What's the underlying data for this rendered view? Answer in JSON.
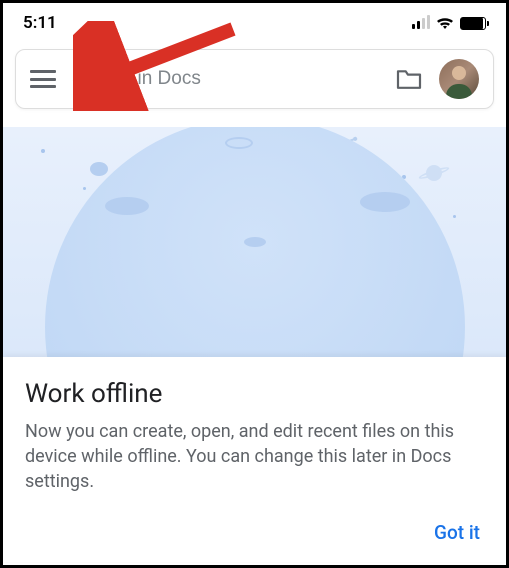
{
  "status_bar": {
    "time": "5:11"
  },
  "search": {
    "placeholder": "Search in Docs"
  },
  "card": {
    "title": "Work offline",
    "body": "Now you can create, open, and edit recent files on this device while offline. You can change this later in Docs settings.",
    "action_label": "Got it"
  },
  "colors": {
    "accent": "#1a73e8",
    "flag": "#1a5dd4"
  }
}
